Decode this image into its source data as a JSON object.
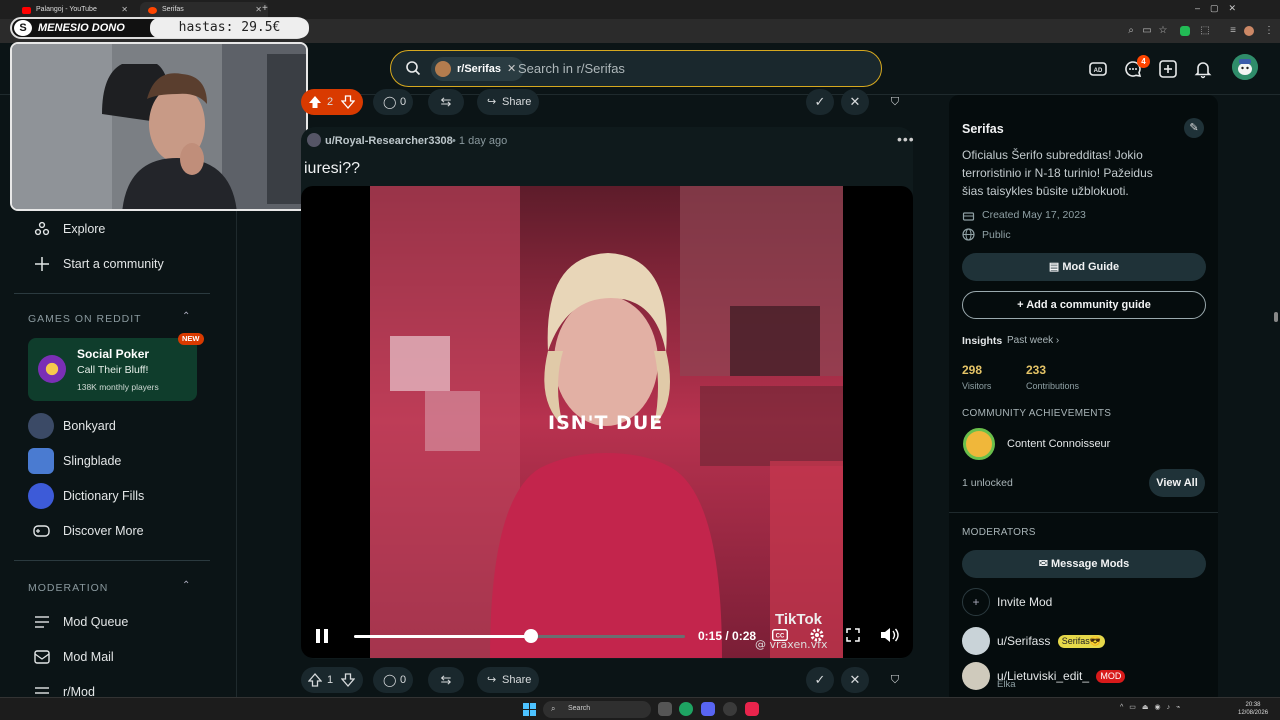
{
  "browser": {
    "tabs": [
      {
        "label": "Palangoj - YouTube",
        "color": "#ff0000"
      },
      {
        "label": "Serifas",
        "color": "#ff4500"
      }
    ]
  },
  "stream_overlay": {
    "donation_label": "MENESIO DONO",
    "donation_goal": "hastas: 29.5€"
  },
  "header": {
    "search_chip": "r/Serifas",
    "search_placeholder": "Search in r/Serifas",
    "chat_badge": "4"
  },
  "left_sidebar": {
    "nav": [
      {
        "label": "Explore",
        "icon": "explore-icon"
      },
      {
        "label": "Start a community",
        "icon": "plus-icon"
      }
    ],
    "games_header": "GAMES ON REDDIT",
    "featured_game": {
      "title": "Social Poker",
      "subtitle": "Call Their Bluff!",
      "players": "138K monthly players",
      "badge": "NEW",
      "logo_text": "SOCIAL POKER"
    },
    "games": [
      {
        "label": "Bonkyard",
        "color": "#3b4a66"
      },
      {
        "label": "Slingblade",
        "color": "#4a7bd1"
      },
      {
        "label": "Dictionary Fills",
        "color": "#3d5bd8"
      },
      {
        "label": "Discover More",
        "color": "transparent"
      }
    ],
    "moderation_header": "MODERATION",
    "moderation": [
      {
        "label": "Mod Queue"
      },
      {
        "label": "Mod Mail"
      },
      {
        "label": "r/Mod"
      }
    ]
  },
  "top_actions": {
    "votes": "2",
    "comments": "0",
    "share": "Share"
  },
  "post": {
    "author": "u/Royal-Researcher3308",
    "age": "• 1 day ago",
    "title": "iuresi??",
    "caption": "ISN'T DUE",
    "watermark": "@ vraxen.vfx",
    "tiktok_label": "TikTok",
    "video_time": "0:15 / 0:28",
    "progress_fraction": 0.536
  },
  "bottom_actions": {
    "votes": "1",
    "comments": "0",
    "share": "Share"
  },
  "right_sidebar": {
    "name": "Serifas",
    "description": "Oficialus Šerifo subredditas! Jokio terroristinio ir N-18 turinio! Pažeidus šias taisykles būsite užblokuoti.",
    "created": "Created May 17, 2023",
    "visibility": "Public",
    "mod_guide": "Mod Guide",
    "add_guide": "Add a community guide",
    "insights_label": "Insights",
    "insights_period": "Past week",
    "visitors_value": "298",
    "visitors_label": "Visitors",
    "contrib_value": "233",
    "contrib_label": "Contributions",
    "achievements_header": "COMMUNITY ACHIEVEMENTS",
    "achievement": "Content Connoisseur",
    "unlocked": "1 unlocked",
    "view_all": "View All",
    "moderators_header": "MODERATORS",
    "message_mods": "Message Mods",
    "invite_mod": "Invite Mod",
    "mods": [
      {
        "name": "u/Serifass",
        "flair": "Serifas😎",
        "flair_color": "#e6d84a"
      },
      {
        "name": "u/Lietuviski_edit_",
        "flair": "MOD",
        "flair_color": "#d81a1a",
        "sub": "Elka"
      }
    ]
  },
  "taskbar": {
    "search": "Search",
    "time": "20:38",
    "date": "12/08/2026"
  },
  "colors": {
    "background": "#0b1416",
    "accent": "#ff4500",
    "search_border": "#d6a81f"
  }
}
